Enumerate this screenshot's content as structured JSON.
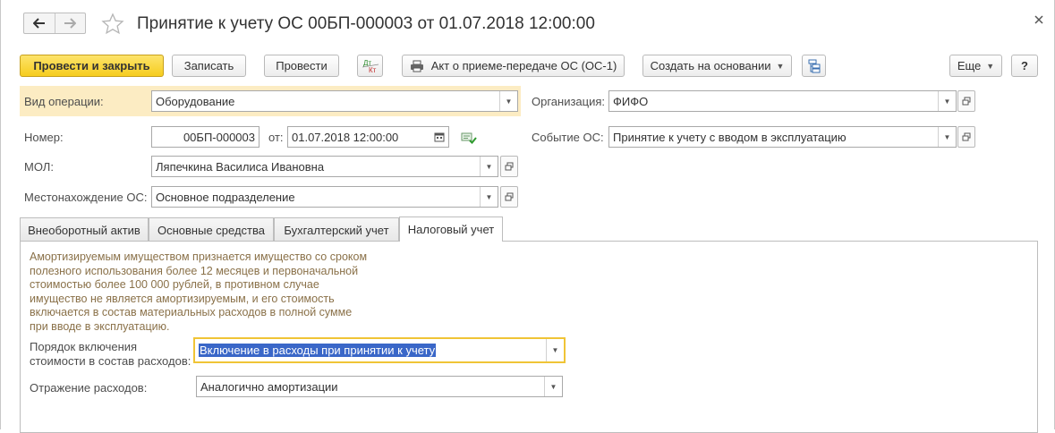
{
  "header": {
    "title": "Принятие к учету ОС 00БП-000003 от 01.07.2018 12:00:00"
  },
  "toolbar": {
    "post_close": "Провести и закрыть",
    "save": "Записать",
    "post": "Провести",
    "dtkt_dt": "Дт",
    "dtkt_kt": "Кт",
    "print_act": "Акт о приеме-передаче ОС (ОС-1)",
    "create_based": "Создать на основании",
    "more": "Еще",
    "help": "?"
  },
  "form": {
    "operation_type": {
      "label": "Вид операции:",
      "value": "Оборудование"
    },
    "number": {
      "label": "Номер:",
      "value": "00БП-000003"
    },
    "date": {
      "label": "от:",
      "value": "01.07.2018 12:00:00"
    },
    "mol": {
      "label": "МОЛ:",
      "value": "Ляпечкина Василиса Ивановна"
    },
    "location": {
      "label": "Местонахождение ОС:",
      "value": "Основное подразделение"
    },
    "organization": {
      "label": "Организация:",
      "value": "ФИФО"
    },
    "event": {
      "label": "Событие ОС:",
      "value": "Принятие к учету с вводом в эксплуатацию"
    }
  },
  "tabs": [
    {
      "label": "Внеоборотный актив"
    },
    {
      "label": "Основные средства"
    },
    {
      "label": "Бухгалтерский учет"
    },
    {
      "label": "Налоговый учет"
    }
  ],
  "tax": {
    "info_lines": [
      "Амортизируемым имуществом признается имущество со сроком",
      "полезного использования более 12 месяцев и первоначальной",
      "стоимостью более 100 000 рублей, в противном случае",
      "имущество не является амортизируемым, и его стоимость",
      "включается в состав материальных расходов в полной сумме",
      "при вводе в эксплуатацию."
    ],
    "inclusion_label_1": "Порядок включения",
    "inclusion_label_2": "стоимости в состав расходов:",
    "inclusion_value": "Включение в расходы при принятии к учету",
    "expense_label": "Отражение расходов:",
    "expense_value": "Аналогично амортизации"
  },
  "colors": {
    "primary_button": "#f6cd1e",
    "highlight_row": "#fcecc3",
    "info_text": "#8a7149",
    "focus_border": "#f0c436"
  }
}
